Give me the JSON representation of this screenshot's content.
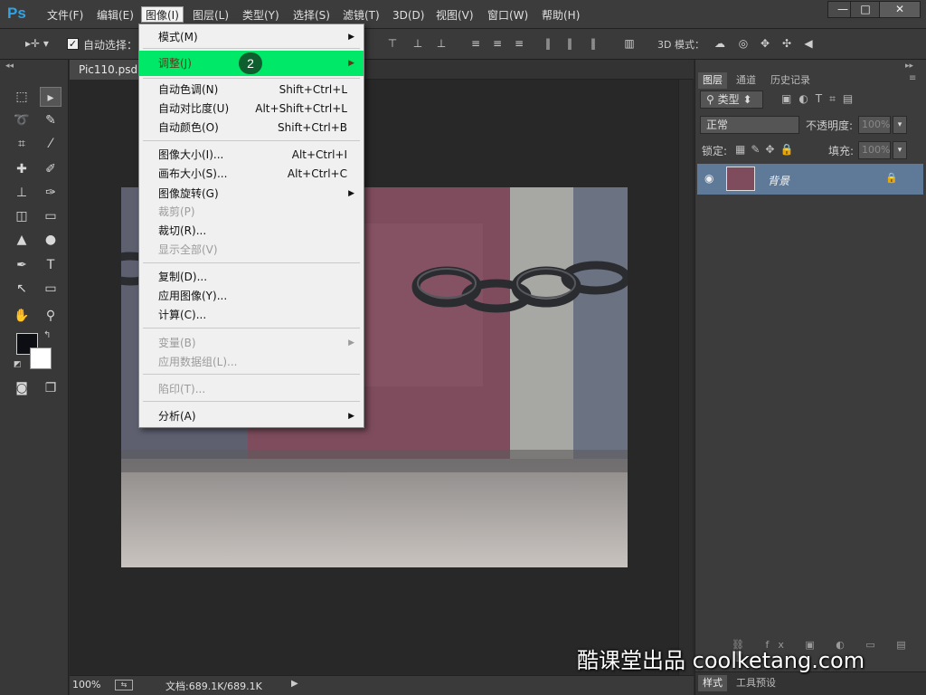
{
  "app": {
    "logo_text": "Ps",
    "menus": [
      "文件(F)",
      "编辑(E)",
      "图像(I)",
      "图层(L)",
      "类型(Y)",
      "选择(S)",
      "滤镜(T)",
      "3D(D)",
      "视图(V)",
      "窗口(W)",
      "帮助(H)"
    ],
    "active_menu": "图像(I)",
    "window_buttons": [
      "—",
      "□",
      "✕"
    ]
  },
  "options_bar": {
    "auto_select_label": "自动选择：",
    "auto_select_checked": true,
    "three_d_mode_label": "3D 模式："
  },
  "document": {
    "tab_title": "Pic110.psd @",
    "zoom": "100%",
    "doc_size": "文档:689.1K/689.1K"
  },
  "image_menu": {
    "items": [
      {
        "label": "模式(M)",
        "shortcut": "",
        "submenu": true,
        "disabled": false
      },
      {
        "label": "调整(J)",
        "shortcut": "",
        "submenu": true,
        "disabled": false,
        "highlighted": true
      },
      {
        "label": "自动色调(N)",
        "shortcut": "Shift+Ctrl+L",
        "submenu": false,
        "disabled": false
      },
      {
        "label": "自动对比度(U)",
        "shortcut": "Alt+Shift+Ctrl+L",
        "submenu": false,
        "disabled": false
      },
      {
        "label": "自动颜色(O)",
        "shortcut": "Shift+Ctrl+B",
        "submenu": false,
        "disabled": false
      },
      {
        "label": "图像大小(I)...",
        "shortcut": "Alt+Ctrl+I",
        "submenu": false,
        "disabled": false
      },
      {
        "label": "画布大小(S)...",
        "shortcut": "Alt+Ctrl+C",
        "submenu": false,
        "disabled": false
      },
      {
        "label": "图像旋转(G)",
        "shortcut": "",
        "submenu": true,
        "disabled": false
      },
      {
        "label": "裁剪(P)",
        "shortcut": "",
        "submenu": false,
        "disabled": true
      },
      {
        "label": "裁切(R)...",
        "shortcut": "",
        "submenu": false,
        "disabled": false
      },
      {
        "label": "显示全部(V)",
        "shortcut": "",
        "submenu": false,
        "disabled": true
      },
      {
        "label": "复制(D)...",
        "shortcut": "",
        "submenu": false,
        "disabled": false
      },
      {
        "label": "应用图像(Y)...",
        "shortcut": "",
        "submenu": false,
        "disabled": false
      },
      {
        "label": "计算(C)...",
        "shortcut": "",
        "submenu": false,
        "disabled": false
      },
      {
        "label": "变量(B)",
        "shortcut": "",
        "submenu": true,
        "disabled": true
      },
      {
        "label": "应用数据组(L)...",
        "shortcut": "",
        "submenu": false,
        "disabled": true
      },
      {
        "label": "陷印(T)...",
        "shortcut": "",
        "submenu": false,
        "disabled": true
      },
      {
        "label": "分析(A)",
        "shortcut": "",
        "submenu": true,
        "disabled": false
      }
    ],
    "step_badge": "2"
  },
  "layers_panel": {
    "tabs": [
      "图层",
      "通道",
      "历史记录"
    ],
    "filter_label": "类型",
    "blend_mode": "正常",
    "opacity_label": "不透明度:",
    "opacity_value": "100%",
    "lock_label": "锁定:",
    "fill_label": "填充:",
    "fill_value": "100%",
    "layer_name": "背景",
    "bottom_tabs": [
      "样式",
      "工具预设"
    ]
  },
  "watermark": "酷课堂出品 coolketang.com",
  "colors": {
    "highlight": "#00e868",
    "badge": "#0f5e2e",
    "layer_selected": "#5f7a99",
    "ps_blue": "#2fa3e6"
  }
}
